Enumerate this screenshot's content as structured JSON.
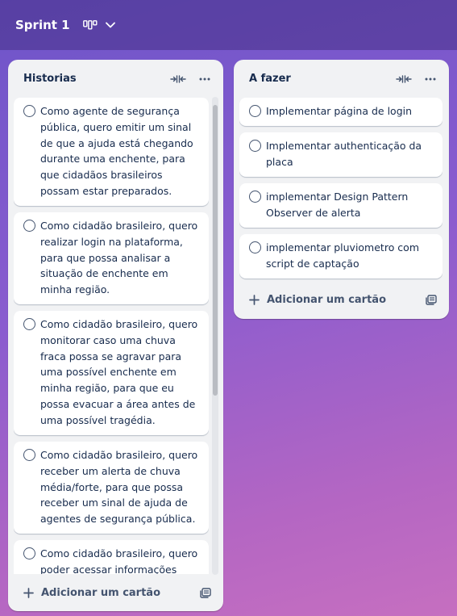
{
  "board": {
    "title": "Sprint 1",
    "view_icon": "board-view-icon",
    "chevron_icon": "chevron-down-icon"
  },
  "lists": [
    {
      "title": "Historias",
      "cards": [
        "Como agente de segurança pública, quero emitir um sinal de que a ajuda está chegando durante uma enchente, para que cidadãos brasileiros possam estar preparados.",
        "Como cidadão brasileiro, quero realizar login na plataforma, para que possa analisar a situação de enchente em minha região.",
        "Como cidadão brasileiro, quero monitorar caso uma chuva fraca possa se agravar para uma possível enchente em minha região, para que eu possa evacuar a área antes de uma possível tragédia.",
        "Como cidadão brasileiro, quero receber um alerta de chuva média/forte, para que possa receber um sinal de ajuda de agentes de segurança pública.",
        "Como cidadão brasileiro, quero poder acessar informações"
      ],
      "add_card_label": "Adicionar um cartão"
    },
    {
      "title": "A fazer",
      "cards": [
        "Implementar página de login",
        "Implementar authenticação da placa",
        "implementar Design Pattern Observer de alerta",
        "implementar pluviometro com script de captação"
      ],
      "add_card_label": "Adicionar um cartão"
    }
  ],
  "colors": {
    "list_bg": "#f1f2f4",
    "card_bg": "#ffffff",
    "text": "#172b4d",
    "muted": "#44546f"
  }
}
